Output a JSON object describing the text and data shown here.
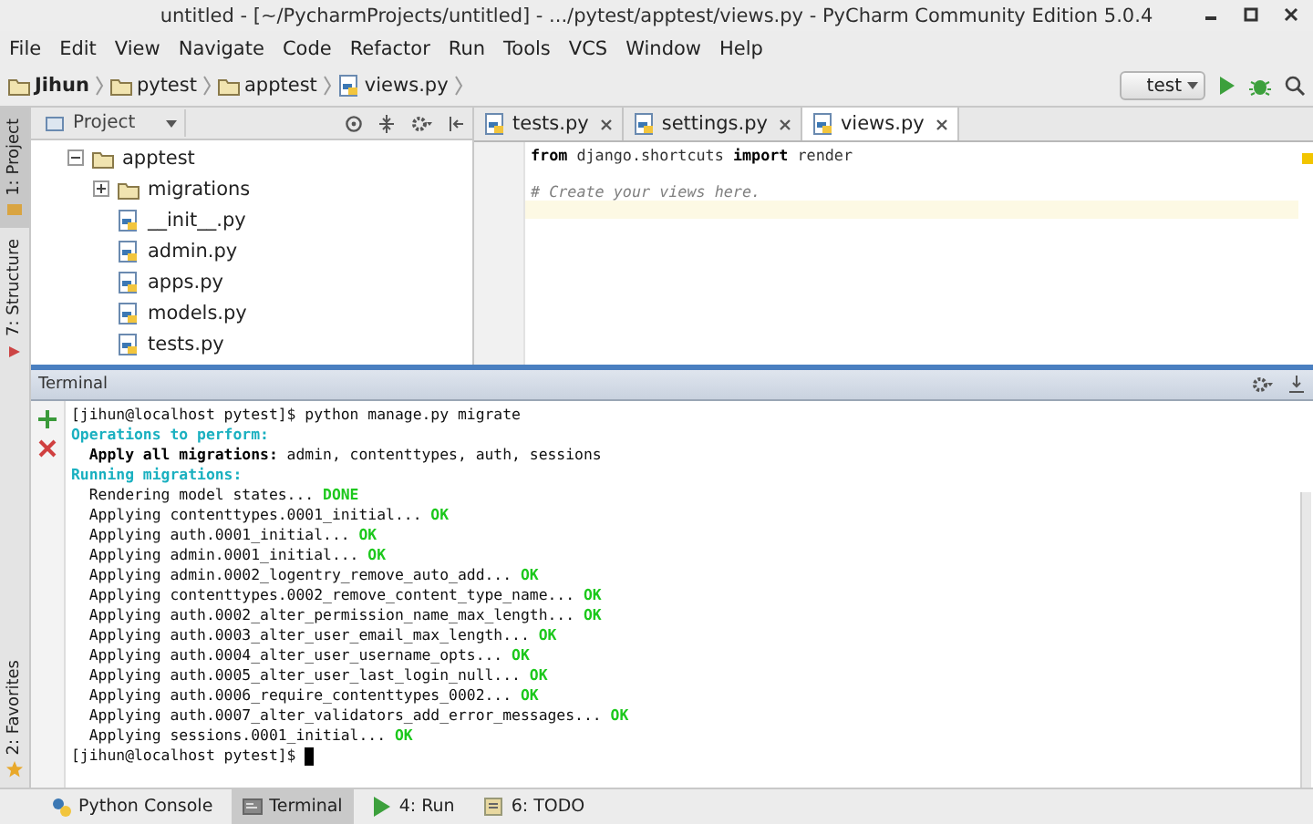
{
  "window": {
    "title": "untitled - [~/PycharmProjects/untitled] - .../pytest/apptest/views.py - PyCharm Community Edition 5.0.4"
  },
  "menu": [
    "File",
    "Edit",
    "View",
    "Navigate",
    "Code",
    "Refactor",
    "Run",
    "Tools",
    "VCS",
    "Window",
    "Help"
  ],
  "breadcrumb": [
    {
      "label": "Jihun",
      "kind": "folder",
      "bold": true
    },
    {
      "label": "pytest",
      "kind": "folder",
      "bold": false
    },
    {
      "label": "apptest",
      "kind": "folder",
      "bold": false
    },
    {
      "label": "views.py",
      "kind": "file",
      "bold": false
    }
  ],
  "run_config": {
    "value": "test"
  },
  "side_tabs": [
    {
      "label": "1: Project",
      "selected": true,
      "kind": "project"
    },
    {
      "label": "7: Structure",
      "selected": false,
      "kind": "structure"
    }
  ],
  "side_tabs_bottom": [
    {
      "label": "2: Favorites",
      "selected": false,
      "kind": "favorites"
    }
  ],
  "project_panel": {
    "title": "Project",
    "tree": [
      {
        "label": "apptest",
        "kind": "folder",
        "expanded": true,
        "children": [
          {
            "label": "migrations",
            "kind": "folder",
            "expanded": false
          },
          {
            "label": "__init__.py",
            "kind": "file"
          },
          {
            "label": "admin.py",
            "kind": "file"
          },
          {
            "label": "apps.py",
            "kind": "file"
          },
          {
            "label": "models.py",
            "kind": "file"
          },
          {
            "label": "tests.py",
            "kind": "file"
          }
        ]
      }
    ]
  },
  "editor_tabs": [
    {
      "label": "tests.py",
      "selected": false
    },
    {
      "label": "settings.py",
      "selected": false
    },
    {
      "label": "views.py",
      "selected": true
    }
  ],
  "editor_lines": [
    {
      "kind": "code",
      "text": "**from** django.shortcuts **import** render",
      "current": false
    },
    {
      "kind": "blank",
      "current": false
    },
    {
      "kind": "comment",
      "text": "# Create your views here.",
      "current": false
    },
    {
      "kind": "blank",
      "current": true
    }
  ],
  "terminal": {
    "title": "Terminal",
    "lines": [
      [
        {
          "kind": "plain",
          "text": "[jihun@localhost pytest]$ python manage.py migrate"
        }
      ],
      [
        {
          "kind": "info",
          "text": "Operations to perform:"
        }
      ],
      [
        {
          "kind": "bold",
          "text": "  Apply all migrations:"
        },
        {
          "kind": "plain",
          "text": " admin, contenttypes, auth, sessions"
        }
      ],
      [
        {
          "kind": "info",
          "text": "Running migrations:"
        }
      ],
      [
        {
          "kind": "plain",
          "text": "  Rendering model states..."
        },
        {
          "kind": "success",
          "text": " DONE"
        }
      ],
      [
        {
          "kind": "plain",
          "text": "  Applying contenttypes.0001_initial..."
        },
        {
          "kind": "success",
          "text": " OK"
        }
      ],
      [
        {
          "kind": "plain",
          "text": "  Applying auth.0001_initial..."
        },
        {
          "kind": "success",
          "text": " OK"
        }
      ],
      [
        {
          "kind": "plain",
          "text": "  Applying admin.0001_initial..."
        },
        {
          "kind": "success",
          "text": " OK"
        }
      ],
      [
        {
          "kind": "plain",
          "text": "  Applying admin.0002_logentry_remove_auto_add..."
        },
        {
          "kind": "success",
          "text": " OK"
        }
      ],
      [
        {
          "kind": "plain",
          "text": "  Applying contenttypes.0002_remove_content_type_name..."
        },
        {
          "kind": "success",
          "text": " OK"
        }
      ],
      [
        {
          "kind": "plain",
          "text": "  Applying auth.0002_alter_permission_name_max_length..."
        },
        {
          "kind": "success",
          "text": " OK"
        }
      ],
      [
        {
          "kind": "plain",
          "text": "  Applying auth.0003_alter_user_email_max_length..."
        },
        {
          "kind": "success",
          "text": " OK"
        }
      ],
      [
        {
          "kind": "plain",
          "text": "  Applying auth.0004_alter_user_username_opts..."
        },
        {
          "kind": "success",
          "text": " OK"
        }
      ],
      [
        {
          "kind": "plain",
          "text": "  Applying auth.0005_alter_user_last_login_null..."
        },
        {
          "kind": "success",
          "text": " OK"
        }
      ],
      [
        {
          "kind": "plain",
          "text": "  Applying auth.0006_require_contenttypes_0002..."
        },
        {
          "kind": "success",
          "text": " OK"
        }
      ],
      [
        {
          "kind": "plain",
          "text": "  Applying auth.0007_alter_validators_add_error_messages..."
        },
        {
          "kind": "success",
          "text": " OK"
        }
      ],
      [
        {
          "kind": "plain",
          "text": "  Applying sessions.0001_initial..."
        },
        {
          "kind": "success",
          "text": " OK"
        }
      ],
      [
        {
          "kind": "plain",
          "text": "[jihun@localhost pytest]$ "
        },
        {
          "kind": "cursor"
        }
      ]
    ]
  },
  "tool_windows": [
    {
      "label": "Python Console",
      "kind": "console",
      "selected": false
    },
    {
      "label": "Terminal",
      "kind": "terminal",
      "selected": true
    },
    {
      "label": "4: Run",
      "kind": "run",
      "selected": false
    },
    {
      "label": "6: TODO",
      "kind": "todo",
      "selected": false
    }
  ]
}
